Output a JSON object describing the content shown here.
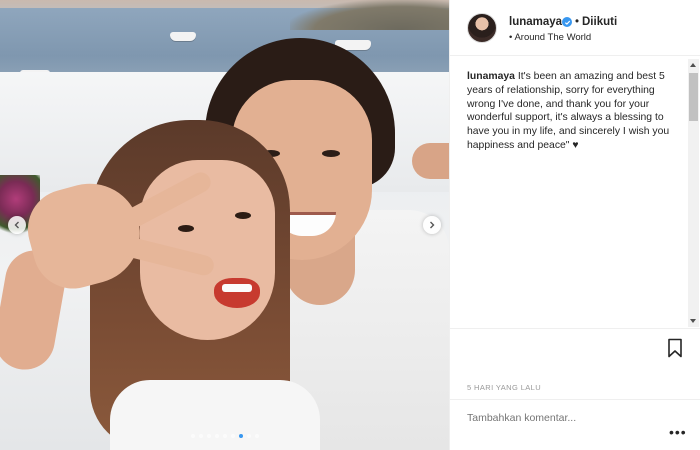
{
  "post": {
    "username": "lunamaya",
    "follow_status": "Diikuti",
    "location": "Around The World",
    "caption_user": "lunamaya",
    "caption_text": "It's been an amazing and best 5 years of relationship, sorry for everything wrong I've done, and thank you for your wonderful support, it's always a blessing to have you in my life, and sincerely I wish you happiness and peace\" ♥",
    "timestamp": "5 HARI YANG LALU",
    "comment_placeholder": "Tambahkan komentar...",
    "more_label": "•••",
    "separator": "•",
    "carousel": {
      "total": 9,
      "active": 6
    }
  },
  "colors": {
    "accent": "#3897f0",
    "text": "#262626",
    "muted": "#999999",
    "border": "#efefef"
  },
  "icons": {
    "prev": "chevron-left-icon",
    "next": "chevron-right-icon",
    "verified": "verified-badge-icon",
    "bookmark": "bookmark-icon",
    "more": "more-options-icon"
  }
}
